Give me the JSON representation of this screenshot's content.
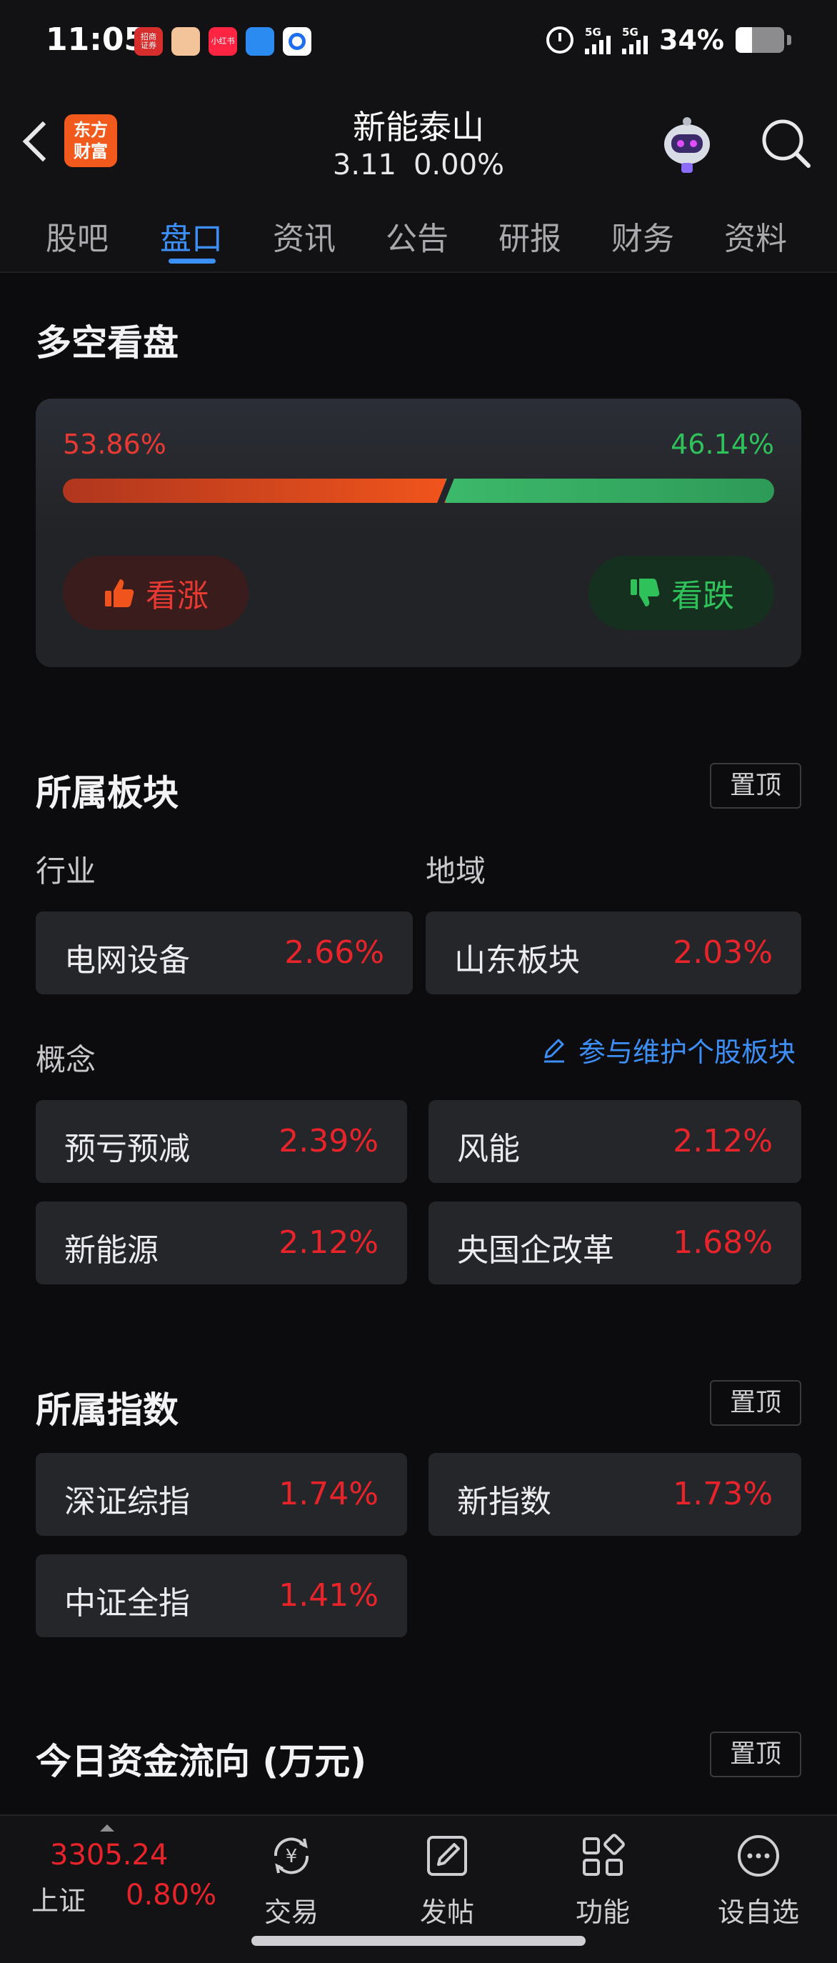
{
  "status_bar": {
    "time": "11:05",
    "apps": [
      {
        "name": "zhaoshang-app-icon",
        "label": "招商\n证券",
        "color": "#d72d2d"
      },
      {
        "name": "pig-app-icon",
        "label": "",
        "color": "#f3c39a"
      },
      {
        "name": "xiaohongshu-app-icon",
        "label": "小红书",
        "color": "#ff2442"
      },
      {
        "name": "blue-app-icon",
        "label": "",
        "color": "#2c8bf0"
      },
      {
        "name": "alipay-app-icon",
        "label": "",
        "color": "#1e6ef5"
      }
    ],
    "network1": "5G",
    "network2": "5G",
    "battery_text": "34%",
    "battery_level": 0.34
  },
  "header": {
    "back_icon": "chevron-left-icon",
    "logo_line1": "东方",
    "logo_line2": "财富",
    "stock_name": "新能泰山",
    "price": "3.11",
    "change": "0.00%"
  },
  "tabs": [
    {
      "label": "股吧",
      "active": false
    },
    {
      "label": "盘口",
      "active": true
    },
    {
      "label": "资讯",
      "active": false
    },
    {
      "label": "公告",
      "active": false
    },
    {
      "label": "研报",
      "active": false
    },
    {
      "label": "财务",
      "active": false
    },
    {
      "label": "资料",
      "active": false
    }
  ],
  "vote": {
    "title": "多空看盘",
    "bull_pct_text": "53.86%",
    "bear_pct_text": "46.14%",
    "bull_ratio": 0.5386,
    "bull_label": "看涨",
    "bear_label": "看跌"
  },
  "sectors": {
    "title": "所属板块",
    "pin_label": "置顶",
    "industry_label": "行业",
    "region_label": "地域",
    "industry": {
      "name": "电网设备",
      "pct": "2.66%"
    },
    "region": {
      "name": "山东板块",
      "pct": "2.03%"
    },
    "concept_label": "概念",
    "maintain_link": "参与维护个股板块",
    "concepts": [
      {
        "name": "预亏预减",
        "pct": "2.39%"
      },
      {
        "name": "风能",
        "pct": "2.12%"
      },
      {
        "name": "新能源",
        "pct": "2.12%"
      },
      {
        "name": "央国企改革",
        "pct": "1.68%"
      }
    ]
  },
  "indices": {
    "title": "所属指数",
    "pin_label": "置顶",
    "items": [
      {
        "name": "深证综指",
        "pct": "1.74%"
      },
      {
        "name": "新指数",
        "pct": "1.73%"
      },
      {
        "name": "中证全指",
        "pct": "1.41%"
      }
    ]
  },
  "fund_flow": {
    "title": "今日资金流向 (万元)",
    "pin_label": "置顶"
  },
  "bottom_nav": {
    "index_value": "3305.24",
    "index_name": "上证",
    "index_pct": "0.80%",
    "items": [
      {
        "label": "交易",
        "icon": "yuan-exchange-icon"
      },
      {
        "label": "发帖",
        "icon": "edit-icon"
      },
      {
        "label": "功能",
        "icon": "grid-icon"
      },
      {
        "label": "设自选",
        "icon": "more-icon"
      }
    ]
  },
  "colors": {
    "up": "#e8242a",
    "down": "#2fc25b",
    "accent": "#3b8ff6",
    "background": "#0c0c0e"
  }
}
